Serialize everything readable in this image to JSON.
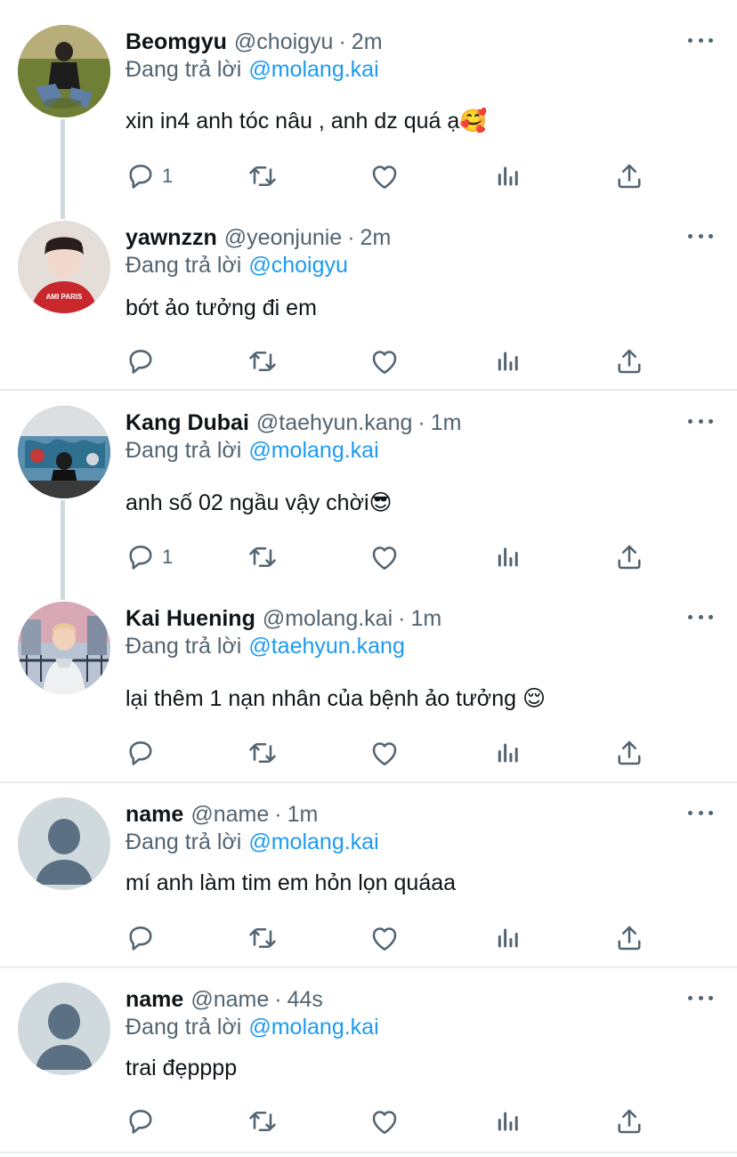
{
  "tweets": [
    {
      "name": "Beomgyu",
      "handle": "@choigyu",
      "time": "2m",
      "reply_prefix": "Đang trả lời",
      "reply_to": "@molang.kai",
      "text": "xin in4 anh tóc nâu , anh dz quá ạ🥰",
      "reply_count": "1",
      "avatar_desc": "boy-sitting-grass"
    },
    {
      "name": "yawnzzn",
      "handle": "@yeonjunie",
      "time": "2m",
      "reply_prefix": "Đang trả lời",
      "reply_to": "@choigyu",
      "text": "bớt ảo tưởng đi em",
      "reply_count": "",
      "avatar_desc": "boy-red-hoodie",
      "hoodie_text": "AMI PARIS"
    },
    {
      "name": "Kang Dubai",
      "handle": "@taehyun.kang",
      "time": "1m",
      "reply_prefix": "Đang trả lời",
      "reply_to": "@molang.kai",
      "text": "anh số 02 ngầu vậy chời😎",
      "reply_count": "1",
      "avatar_desc": "graffiti-wall"
    },
    {
      "name": "Kai Huening",
      "handle": "@molang.kai",
      "time": "1m",
      "reply_prefix": "Đang trả lời",
      "reply_to": "@taehyun.kang",
      "text": "lại thêm 1 nạn nhân của bệnh ảo tưởng 😌",
      "reply_count": "",
      "avatar_desc": "boy-white-hoodie"
    },
    {
      "name": "name",
      "handle": "@name",
      "time": "1m",
      "reply_prefix": "Đang trả lời",
      "reply_to": "@molang.kai",
      "text": "mí anh làm tim em hỏn lọn quáaa",
      "reply_count": "",
      "avatar_desc": "default-avatar"
    },
    {
      "name": "name",
      "handle": "@name",
      "time": "44s",
      "reply_prefix": "Đang trả lời",
      "reply_to": "@molang.kai",
      "text": "trai đẹpppp",
      "reply_count": "",
      "avatar_desc": "default-avatar"
    }
  ],
  "icons": {
    "reply": "reply-icon",
    "retweet": "retweet-icon",
    "like": "heart-icon",
    "analytics": "analytics-icon",
    "share": "share-icon",
    "more": "more-icon"
  },
  "colors": {
    "mention": "#1d9bf0",
    "secondary_text": "#536471",
    "divider": "#e6ecf0"
  }
}
